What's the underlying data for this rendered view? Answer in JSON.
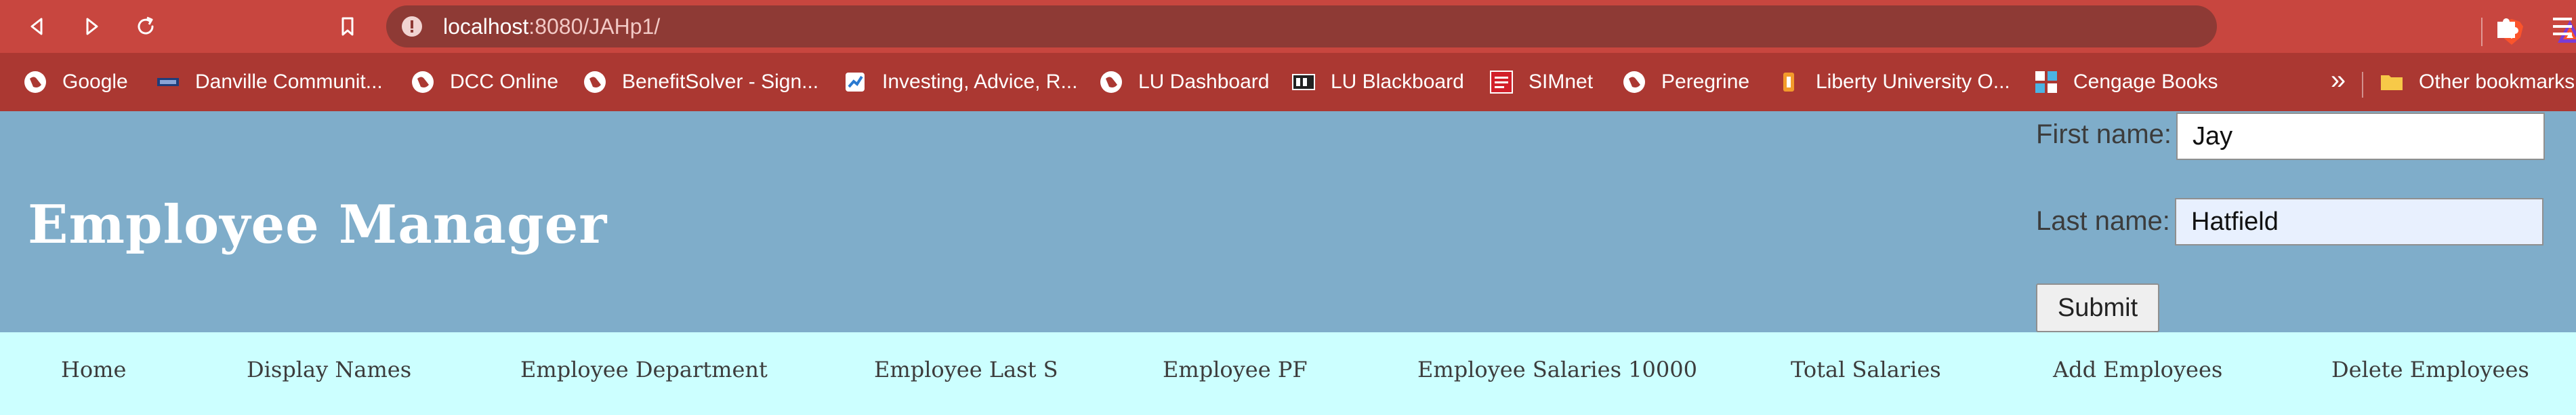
{
  "browser": {
    "url_host": "localhost",
    "url_path": ":8080/JAHp1/",
    "icons": {
      "back": "back-arrow-icon",
      "forward": "forward-arrow-icon",
      "reload": "reload-icon",
      "bookmark": "bookmark-icon",
      "info": "info-icon",
      "brave": "brave-lion-icon",
      "rewards": "brave-rewards-icon",
      "extensions": "puzzle-piece-icon",
      "menu": "three-line-menu-icon"
    },
    "colors": {
      "toolbar": "#c8463f",
      "address_bar": "#8e3a35",
      "bookmarks_bar": "#ab3832"
    }
  },
  "bookmarks": {
    "items": [
      {
        "label": "Google",
        "icon": "globe-icon"
      },
      {
        "label": "Danville Communit...",
        "icon": "site-logo-icon"
      },
      {
        "label": "DCC Online",
        "icon": "globe-icon"
      },
      {
        "label": "BenefitSolver - Sign...",
        "icon": "globe-icon"
      },
      {
        "label": "Investing, Advice, R...",
        "icon": "site-logo-icon"
      },
      {
        "label": "LU Dashboard",
        "icon": "globe-icon"
      },
      {
        "label": "LU Blackboard",
        "icon": "blackboard-logo-icon"
      },
      {
        "label": "SIMnet",
        "icon": "mcgraw-hill-logo-icon"
      },
      {
        "label": "Peregrine",
        "icon": "globe-icon"
      },
      {
        "label": "Liberty University O...",
        "icon": "liberty-logo-icon"
      },
      {
        "label": "Cengage Books",
        "icon": "cengage-logo-icon"
      }
    ],
    "overflow_label": "»",
    "other_bookmarks": {
      "label": "Other bookmarks",
      "icon": "folder-icon"
    }
  },
  "page": {
    "title": "Employee Manager",
    "header_color": "#7fadca",
    "nav_color": "#ccffff",
    "form": {
      "first_name_label": "First name:",
      "first_name_value": "Jay",
      "last_name_label": "Last name:",
      "last_name_value": "Hatfield",
      "submit_label": "Submit"
    },
    "nav": [
      {
        "label": "Home"
      },
      {
        "label": "Display Names"
      },
      {
        "label": "Employee Department"
      },
      {
        "label": "Employee Last S"
      },
      {
        "label": "Employee PF"
      },
      {
        "label": "Employee Salaries 10000"
      },
      {
        "label": "Total Salaries"
      },
      {
        "label": "Add Employees"
      },
      {
        "label": "Delete Employees"
      }
    ]
  }
}
